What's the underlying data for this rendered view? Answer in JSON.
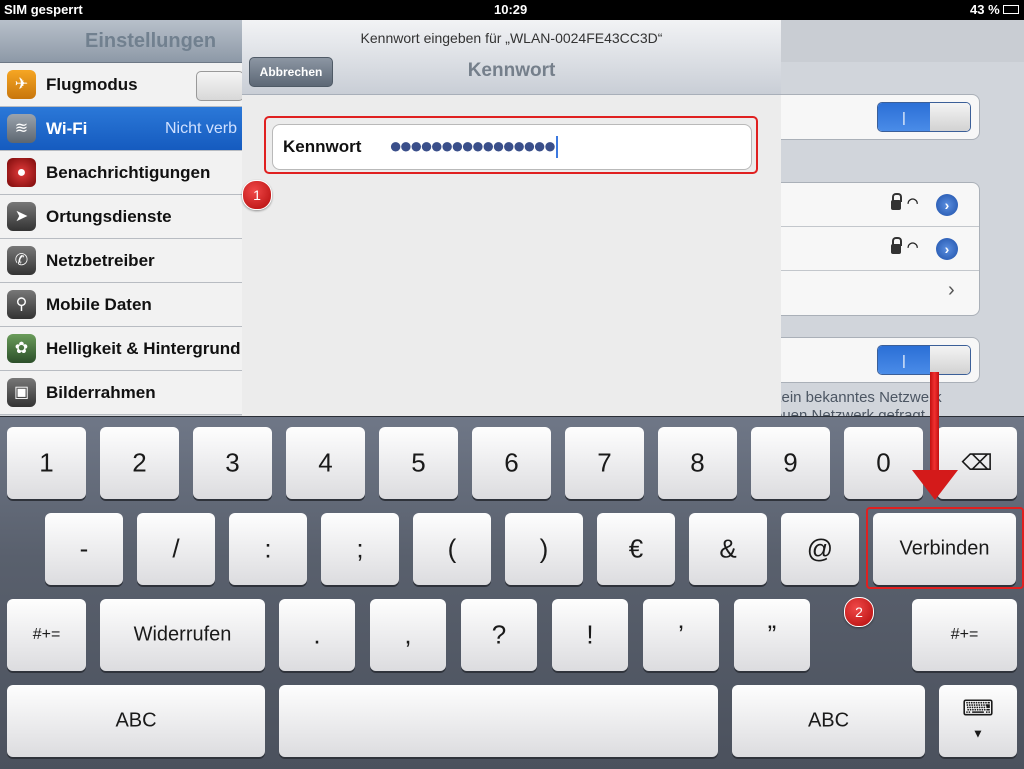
{
  "status_bar": {
    "carrier": "SIM gesperrt",
    "time": "10:29",
    "battery": "43 %"
  },
  "sidebar": {
    "title": "Einstellungen",
    "items": [
      {
        "label": "Flugmodus",
        "icon": "airplane-icon"
      },
      {
        "label": "Wi-Fi",
        "value": "Nicht verb",
        "icon": "wifi-icon"
      },
      {
        "label": "Benachrichtigungen",
        "icon": "notifications-icon"
      },
      {
        "label": "Ortungsdienste",
        "icon": "location-icon"
      },
      {
        "label": "Netzbetreiber",
        "icon": "phone-icon"
      },
      {
        "label": "Mobile Daten",
        "icon": "antenna-icon"
      },
      {
        "label": "Helligkeit & Hintergrund",
        "icon": "flower-icon"
      },
      {
        "label": "Bilderrahmen",
        "icon": "picture-frame-icon"
      }
    ]
  },
  "detail": {
    "note_line1": "kein bekanntes Netzwerk",
    "note_line2": "euen Netzwerk gefragt"
  },
  "modal": {
    "subtitle": "Kennwort eingeben für „WLAN-0024FE43CC3D“",
    "title": "Kennwort",
    "cancel_label": "Abbrechen",
    "password_label": "Kennwort",
    "password_value": "●●●●●●●●●●●●●●●●"
  },
  "annotations": {
    "badge1": "1",
    "badge2": "2"
  },
  "keyboard": {
    "row1": [
      "1",
      "2",
      "3",
      "4",
      "5",
      "6",
      "7",
      "8",
      "9",
      "0"
    ],
    "row2": [
      "-",
      "/",
      ":",
      ";",
      "(",
      ")",
      "€",
      "&",
      "@"
    ],
    "connect_label": "Verbinden",
    "shift_label": "#+=",
    "undo_label": "Widerrufen",
    "row3": [
      ".",
      ",",
      "?",
      "!",
      "’",
      "”"
    ],
    "shift_right_label": "#+=",
    "abc_label": "ABC",
    "abc_right_label": "ABC"
  },
  "colors": {
    "accent": "#1d62c9",
    "highlight": "#e02020"
  }
}
